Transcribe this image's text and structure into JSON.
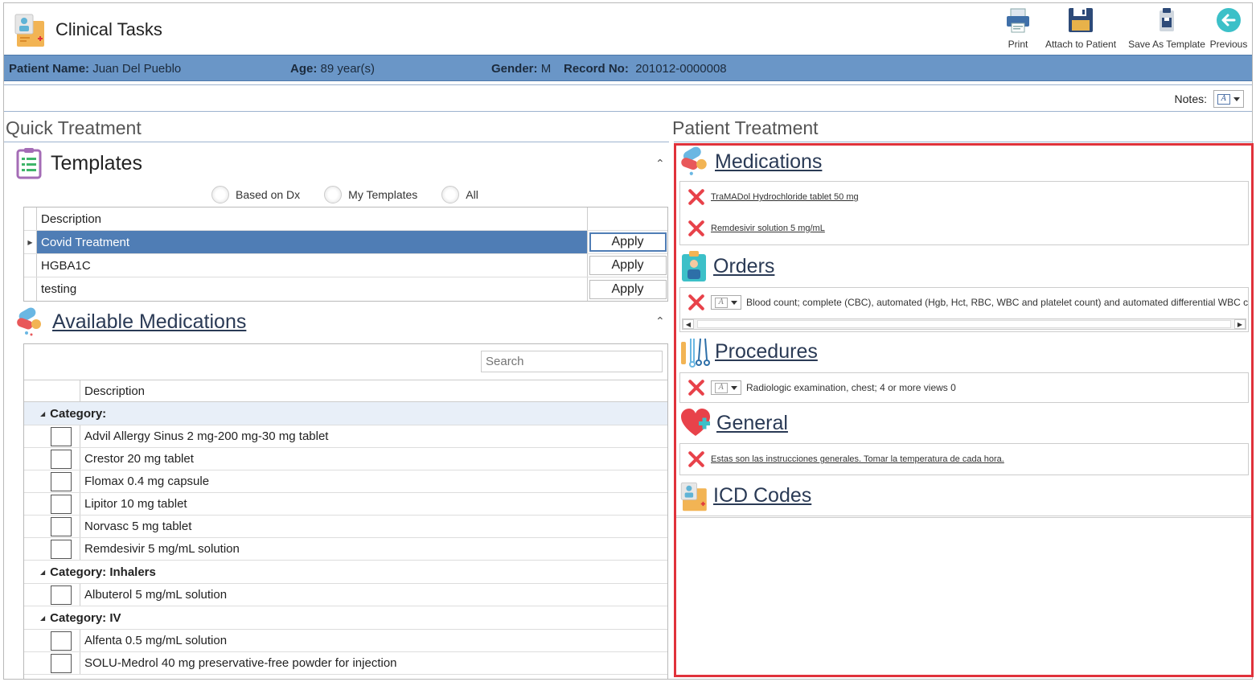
{
  "app": {
    "title": "Clinical Tasks"
  },
  "toolbar": {
    "print": "Print",
    "attach": "Attach to Patient",
    "save_template": "Save As Template",
    "previous": "Previous"
  },
  "patient": {
    "name_label": "Patient Name:",
    "name": "Juan Del Pueblo",
    "age_label": "Age:",
    "age": "89 year(s)",
    "gender_label": "Gender:",
    "gender": "M",
    "record_label": "Record No:",
    "record": "201012-0000008"
  },
  "notes_label": "Notes:",
  "quick_treatment": {
    "title": "Quick Treatment",
    "templates": {
      "title": "Templates",
      "filters": [
        "Based on Dx",
        "My Templates",
        "All"
      ],
      "column": "Description",
      "rows": [
        {
          "desc": "Covid Treatment",
          "action": "Apply"
        },
        {
          "desc": "HGBA1C",
          "action": "Apply"
        },
        {
          "desc": "testing",
          "action": "Apply"
        }
      ]
    },
    "available_medications": {
      "title": "Available Medications",
      "search_placeholder": "Search",
      "column": "Description",
      "categories": [
        {
          "label": "Category:",
          "items": [
            "Advil Allergy Sinus 2 mg-200 mg-30 mg tablet",
            "Crestor 20 mg tablet",
            "Flomax 0.4 mg capsule",
            "Lipitor 10 mg tablet",
            "Norvasc 5 mg tablet",
            "Remdesivir 5 mg/mL solution"
          ]
        },
        {
          "label": "Category: Inhalers",
          "items": [
            "Albuterol 5 mg/mL solution"
          ]
        },
        {
          "label": "Category: IV",
          "items": [
            "Alfenta 0.5 mg/mL solution",
            "SOLU-Medrol 40 mg preservative-free powder for injection"
          ]
        }
      ]
    }
  },
  "patient_treatment": {
    "title": "Patient Treatment",
    "medications": {
      "title": "Medications",
      "items": [
        "TraMADol Hydrochloride tablet 50 mg",
        "Remdesivir solution 5 mg/mL"
      ]
    },
    "orders": {
      "title": "Orders",
      "items": [
        "Blood count; complete (CBC), automated (Hgb, Hct, RBC, WBC and platelet count) and automated differential WBC cou"
      ]
    },
    "procedures": {
      "title": "Procedures",
      "items": [
        "Radiologic examination, chest; 4 or more views 0"
      ]
    },
    "general": {
      "title": "General",
      "items": [
        "Estas son las instrucciones generales. Tomar la temperatura de cada hora."
      ]
    },
    "icd": {
      "title": "ICD Codes"
    }
  }
}
